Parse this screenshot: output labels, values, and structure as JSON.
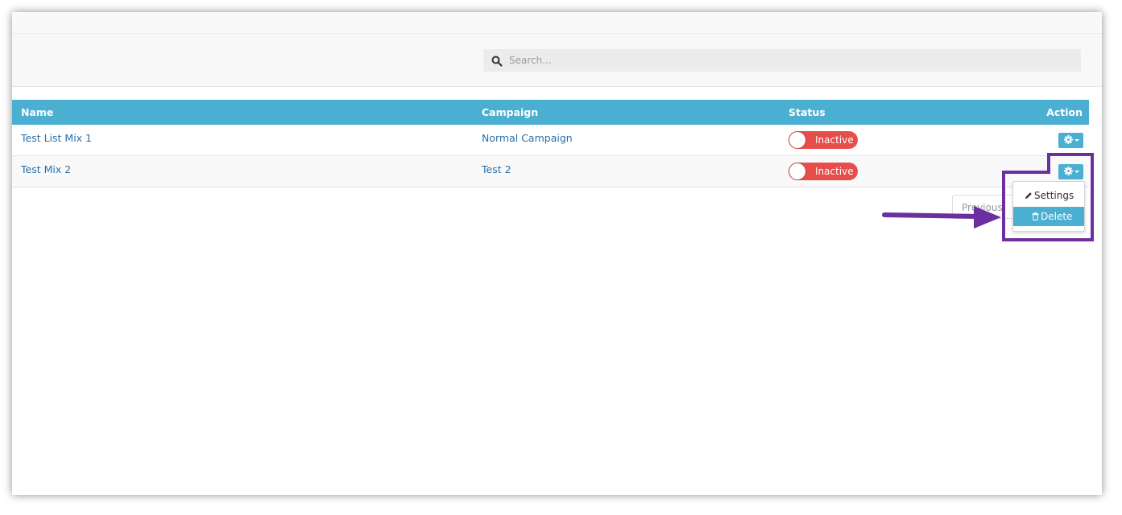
{
  "search": {
    "placeholder": "Search..."
  },
  "table": {
    "headers": {
      "name": "Name",
      "campaign": "Campaign",
      "status": "Status",
      "action": "Action"
    },
    "rows": [
      {
        "name": "Test List Mix 1",
        "campaign": "Normal Campaign",
        "status": "Inactive"
      },
      {
        "name": "Test Mix 2",
        "campaign": "Test 2",
        "status": "Inactive"
      }
    ]
  },
  "pagination": {
    "previous": "Previous"
  },
  "dropdown": {
    "settings": "Settings",
    "delete": "Delete"
  },
  "icons": {
    "search": "search-icon",
    "gear": "gear-icon",
    "pencil": "pencil-icon",
    "trash": "trash-icon",
    "arrow": "arrow-right-icon"
  },
  "colors": {
    "header": "#4bafd2",
    "toggle_inactive": "#e74d4a",
    "annotation": "#6b2fa0",
    "link": "#2a6fa6"
  }
}
